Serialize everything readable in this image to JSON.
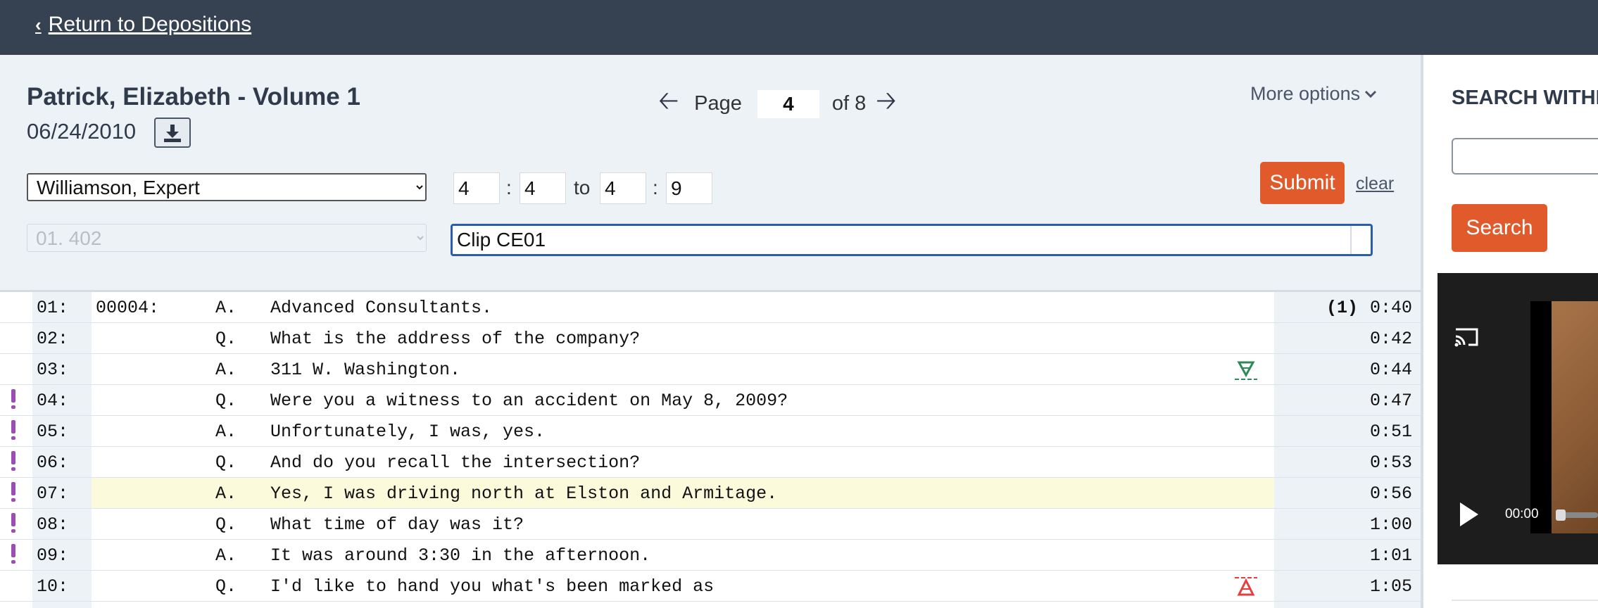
{
  "nav": {
    "back_label": "Return to Depositions"
  },
  "deposition": {
    "title": "Patrick, Elizabeth - Volume 1",
    "date": "06/24/2010"
  },
  "pager": {
    "page_label": "Page",
    "current_page": "4",
    "of_label": "of 8"
  },
  "more_options_label": "More options",
  "form": {
    "witness_select": "Williamson, Expert",
    "exhibit_select": "01. 402",
    "from_page": "4",
    "from_line": "4",
    "to_label": "to",
    "to_page": "4",
    "to_line": "9",
    "colon": ":",
    "clip_name": "Clip CE01",
    "submit_label": "Submit",
    "clear_label": "clear"
  },
  "transcript": {
    "rows": [
      {
        "line": "01:",
        "page": "00004:",
        "speaker": "A.",
        "text": "Advanced Consultants.",
        "clip": "(1)",
        "time": "0:40",
        "marked": false,
        "highlighted": false
      },
      {
        "line": "02:",
        "page": "",
        "speaker": "Q.",
        "text": "What is the address of the company?",
        "clip": "",
        "time": "0:42",
        "marked": false,
        "highlighted": false
      },
      {
        "line": "03:",
        "page": "",
        "speaker": "A.",
        "text": "311 W. Washington.",
        "clip": "",
        "time": "0:44",
        "marked": false,
        "highlighted": false
      },
      {
        "line": "04:",
        "page": "",
        "speaker": "Q.",
        "text": "Were you a witness to an accident on May 8, 2009?",
        "clip": "",
        "time": "0:47",
        "marked": true,
        "highlighted": false
      },
      {
        "line": "05:",
        "page": "",
        "speaker": "A.",
        "text": "Unfortunately, I was, yes.",
        "clip": "",
        "time": "0:51",
        "marked": true,
        "highlighted": false
      },
      {
        "line": "06:",
        "page": "",
        "speaker": "Q.",
        "text": "And do you recall the intersection?",
        "clip": "",
        "time": "0:53",
        "marked": true,
        "highlighted": false
      },
      {
        "line": "07:",
        "page": "",
        "speaker": "A.",
        "text": "Yes, I was driving north at Elston and Armitage.",
        "clip": "",
        "time": "0:56",
        "marked": true,
        "highlighted": true
      },
      {
        "line": "08:",
        "page": "",
        "speaker": "Q.",
        "text": "What time of day was it?",
        "clip": "",
        "time": "1:00",
        "marked": true,
        "highlighted": false
      },
      {
        "line": "09:",
        "page": "",
        "speaker": "A.",
        "text": "It was around 3:30 in the afternoon.",
        "clip": "",
        "time": "1:01",
        "marked": true,
        "highlighted": false
      },
      {
        "line": "10:",
        "page": "",
        "speaker": "Q.",
        "text": "I'd like to hand you what's been marked as",
        "clip": "",
        "time": "1:05",
        "marked": false,
        "highlighted": false
      }
    ],
    "clip_markers": [
      {
        "row": 3,
        "type": "clip-end-marker",
        "color": "#2e8b57"
      },
      {
        "row": 10,
        "type": "clip-start-marker",
        "color": "#e53e3e"
      }
    ]
  },
  "search_panel": {
    "heading": "SEARCH WITHIN",
    "button_label": "Search",
    "query": ""
  },
  "video": {
    "time": "00:00"
  },
  "colors": {
    "topbar": "#364152",
    "accent": "#e05a2b",
    "mark": "#9b4fb5",
    "highlight": "#fbfbdc"
  }
}
